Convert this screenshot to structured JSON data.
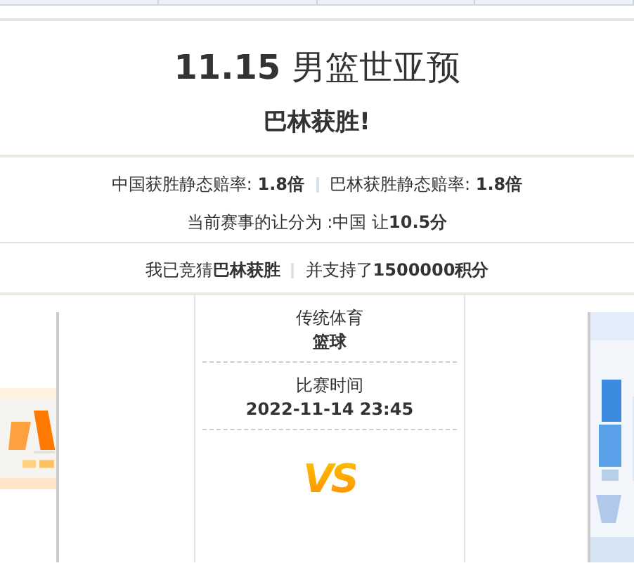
{
  "title": "**11.15** 男篮世亚预",
  "result": "巴林获胜!",
  "odds": [
    {
      "text": "中国获胜静态赔率: **1.8倍**"
    },
    {
      "text": "巴林获胜静态赔率: **1.8倍**"
    }
  ],
  "handicap": "当前赛事的让分为 :中国 让**10.5分**",
  "bet": [
    {
      "text": "我已竞猜**巴林获胜**"
    },
    {
      "text": "并支持了**1500000积分**"
    }
  ],
  "match": {
    "sport_label": "传统体育",
    "sport": "篮球",
    "time_label": "比赛时间",
    "time": "2022-11-14 23:45",
    "vs": "VS"
  }
}
